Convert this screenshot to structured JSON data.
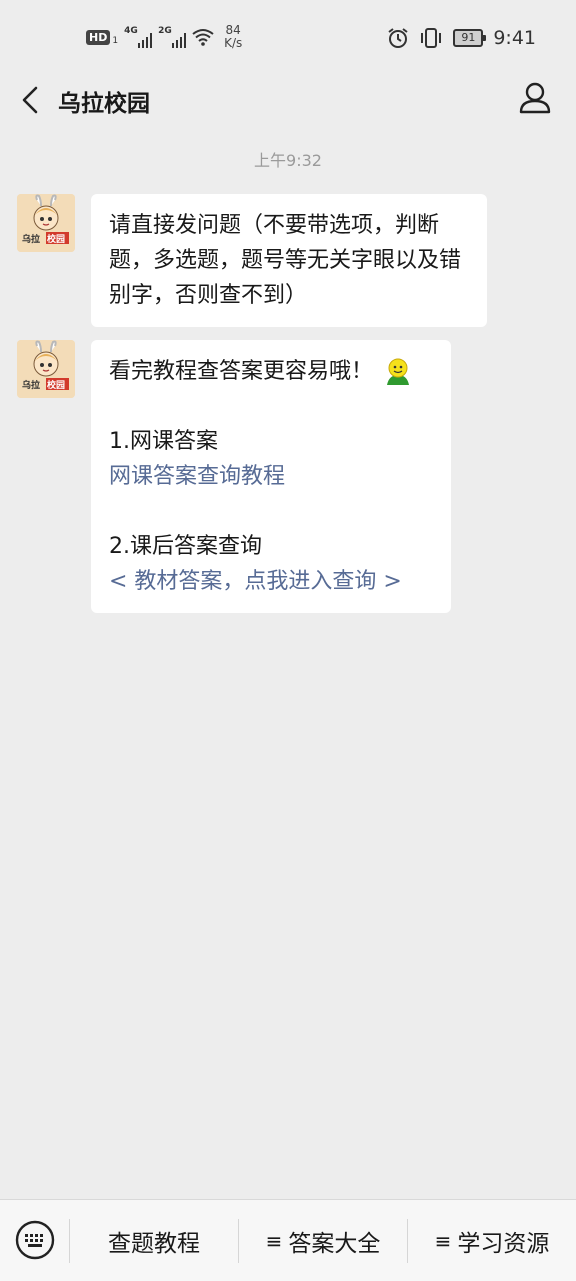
{
  "status_bar": {
    "hd_badge": "HD",
    "hd_sub": "1",
    "network1": "4G",
    "network2": "2G",
    "speed_value": "84",
    "speed_unit": "K/s",
    "battery": "91",
    "time": "9:41"
  },
  "header": {
    "title": "乌拉校园",
    "back_icon": "chevron-left-icon",
    "profile_icon": "person-icon"
  },
  "timestamp": "上午9:32",
  "avatar_label": {
    "left": "乌拉",
    "right": "校园"
  },
  "messages": [
    {
      "text": "请直接发问题（不要带选项，判断题，多选题，题号等无关字眼以及错别字，否则查不到）"
    },
    {
      "intro": "看完教程查答案更容易哦！",
      "emoji": "smiley-face-icon",
      "section1_title": "1.网课答案",
      "section1_link": "网课答案查询教程",
      "section2_title": "2.课后答案查询",
      "section2_link": "< 教材答案，点我进入查询 >"
    }
  ],
  "bottom_menu": {
    "keyboard_icon": "keyboard-icon",
    "items": [
      {
        "label": "查题教程"
      },
      {
        "glyph": "≡",
        "label": "答案大全"
      },
      {
        "glyph": "≡",
        "label": "学习资源"
      }
    ]
  },
  "colors": {
    "background": "#ededed",
    "bubble": "#ffffff",
    "link": "#576b95",
    "bottom_bar": "#f7f7f7"
  }
}
